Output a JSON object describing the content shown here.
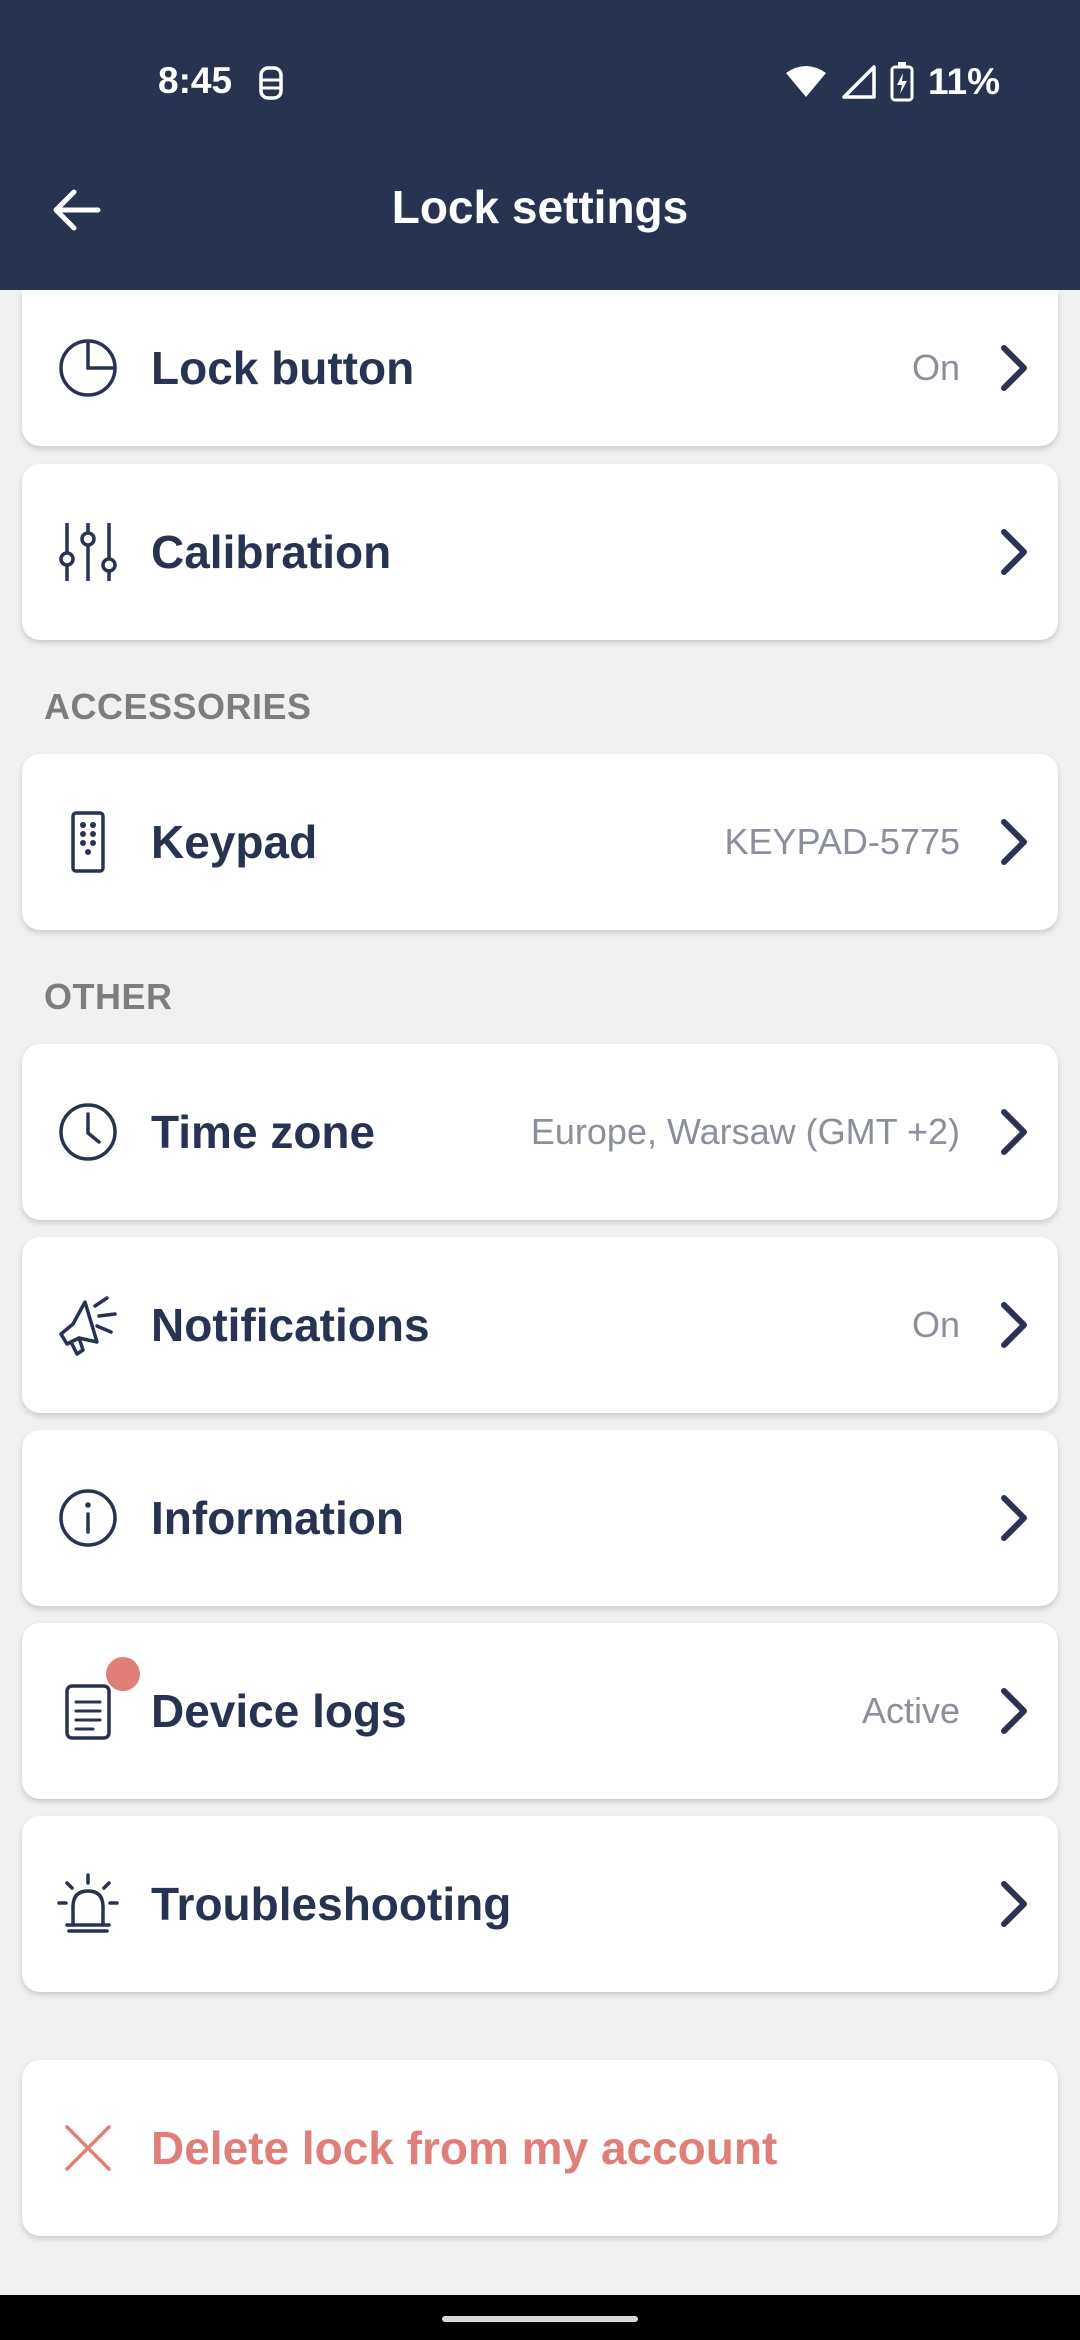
{
  "status_bar": {
    "time": "8:45",
    "battery_percent": "11%",
    "icons": [
      "lock-notification-icon",
      "wifi-icon",
      "signal-icon",
      "battery-charging-icon"
    ]
  },
  "app_bar": {
    "title": "Lock settings",
    "back_icon": "arrow-left-icon"
  },
  "colors": {
    "header_bg": "#283352",
    "page_bg": "#f1f1f1",
    "text_primary": "#283352",
    "text_secondary": "#8b8f9c",
    "section_header": "#7d7d7d",
    "danger": "#e07f79"
  },
  "settings": {
    "lock_button": {
      "label": "Lock button",
      "value": "On",
      "icon": "lock-button-icon"
    },
    "calibration": {
      "label": "Calibration",
      "value": "",
      "icon": "sliders-icon"
    }
  },
  "accessories": {
    "header": "ACCESSORIES",
    "keypad": {
      "label": "Keypad",
      "value": "KEYPAD-5775",
      "icon": "keypad-icon"
    }
  },
  "other": {
    "header": "OTHER",
    "time_zone": {
      "label": "Time zone",
      "value": "Europe, Warsaw (GMT +2)",
      "icon": "clock-icon"
    },
    "notifications": {
      "label": "Notifications",
      "value": "On",
      "icon": "megaphone-icon"
    },
    "information": {
      "label": "Information",
      "value": "",
      "icon": "info-icon"
    },
    "device_logs": {
      "label": "Device logs",
      "value": "Active",
      "icon": "document-icon",
      "badge": true
    },
    "troubleshooting": {
      "label": "Troubleshooting",
      "value": "",
      "icon": "alarm-icon"
    }
  },
  "delete": {
    "label": "Delete lock from my account",
    "icon": "close-icon"
  }
}
